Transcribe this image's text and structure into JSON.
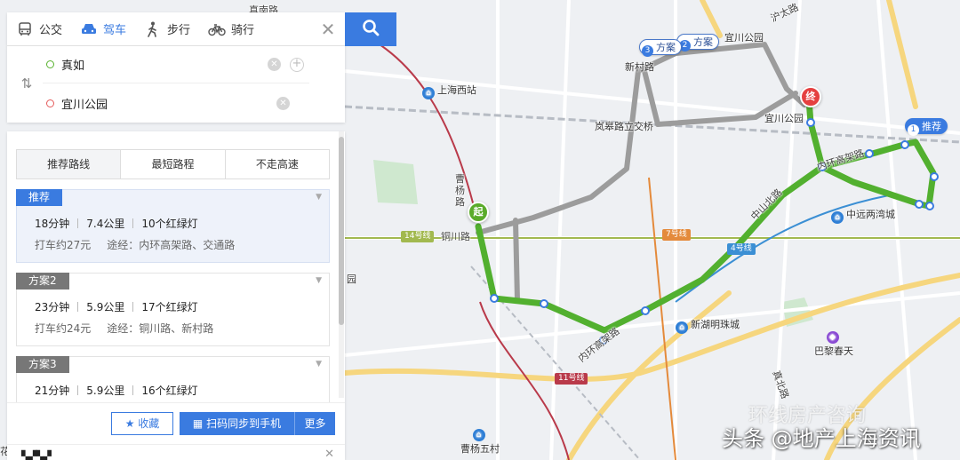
{
  "modes": [
    {
      "label": "公交",
      "icon": "bus-icon"
    },
    {
      "label": "驾车",
      "icon": "car-icon"
    },
    {
      "label": "步行",
      "icon": "walk-icon"
    },
    {
      "label": "骑行",
      "icon": "bike-icon"
    }
  ],
  "active_mode": "驾车",
  "start": {
    "value": "真如"
  },
  "end": {
    "value": "宜川公园"
  },
  "preferences": [
    "推荐路线",
    "最短路程",
    "不走高速"
  ],
  "routes": [
    {
      "tag": "推荐",
      "time": "18分钟",
      "distance": "7.4公里",
      "lights": "10个红绿灯",
      "taxi": "打车约27元",
      "via": "途经：内环高架路、交通路"
    },
    {
      "tag": "方案2",
      "time": "23分钟",
      "distance": "5.9公里",
      "lights": "17个红绿灯",
      "taxi": "打车约24元",
      "via": "途经：铜川路、新村路"
    },
    {
      "tag": "方案3",
      "time": "21分钟",
      "distance": "5.9公里",
      "lights": "16个红绿灯",
      "taxi": "",
      "via": ""
    }
  ],
  "actions": {
    "favorite": "收藏",
    "sync": "扫码同步到手机",
    "more": "更多"
  },
  "map": {
    "pins": {
      "start": "起",
      "end": "终"
    },
    "route_tags": [
      {
        "num": "1",
        "label": "推荐"
      },
      {
        "num": "2",
        "label": "方案"
      },
      {
        "num": "3",
        "label": "方案"
      }
    ],
    "labels": {
      "shanghai_west": "上海西站",
      "xincun_rd": "新村路",
      "langao_rd": "岚皋路立交桥",
      "yichuan_park_top": "宜川公园",
      "yichuan_park": "宜川公园",
      "zhongyuan": "中远两湾城",
      "caoyang_rd": "曹杨路",
      "tongchuan_rd": "铜川路",
      "inner_ring_top": "内环高架路",
      "inner_ring_bottom": "内环高架路",
      "zhongshan_rd": "中山北路",
      "xinhu": "新湖明珠城",
      "bali": "巴黎春天",
      "caoyang5": "曹杨五村",
      "zhenbei": "真北路",
      "huning": "沪太路",
      "gongyuan_left": "园",
      "hua_left": "花",
      "zhenbei_top": "真南路"
    },
    "metro": [
      {
        "label": "14号线",
        "color": "#a2b94f"
      },
      {
        "label": "7号线",
        "color": "#e48a3b"
      },
      {
        "label": "4号线",
        "color": "#3b8fd4"
      },
      {
        "label": "11号线",
        "color": "#b93a4a"
      }
    ]
  },
  "watermark": "头条 @地产上海资讯",
  "watermark_faint": "环线房产咨询",
  "colors": {
    "accent": "#3a7be0",
    "route_main": "#52b02f",
    "route_alt": "#9c9c9c",
    "start_pin": "#5aab2a",
    "end_pin": "#e54040"
  }
}
